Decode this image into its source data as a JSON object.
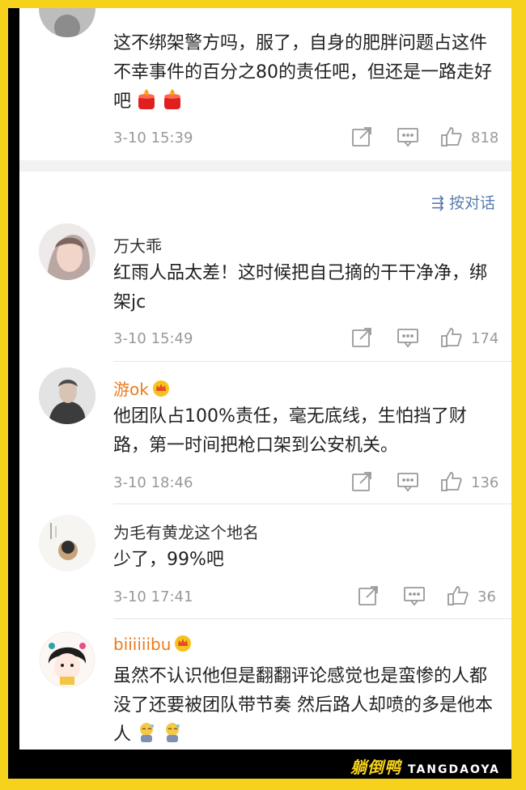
{
  "header": {
    "sort_label": "按对话"
  },
  "comments": [
    {
      "username": "",
      "text": "这不绑架警方吗，服了，自身的肥胖问题占这件不幸事件的百分之80的责任吧，但还是一路走好吧",
      "emojis": [
        "candle-emoji",
        "candle-emoji"
      ],
      "time": "3-10 15:39",
      "likes": "818",
      "vip": false
    },
    {
      "username": "万大乖",
      "text": "红雨人品太差！这时候把自己摘的干干净净，绑架jc",
      "time": "3-10 15:49",
      "likes": "174",
      "vip": false
    },
    {
      "username": "游ok",
      "text": "他团队占100%责任，毫无底线，生怕挡了财路，第一时间把枪口架到公安机关。",
      "time": "3-10 18:46",
      "likes": "136",
      "vip": true
    },
    {
      "username": "为毛有黄龙这个地名",
      "text": "少了，99%吧",
      "time": "3-10 17:41",
      "likes": "36",
      "vip": false
    },
    {
      "username": "biiiiiibu",
      "text": "虽然不认识他但是翻翻评论感觉也是蛮惨的人都没了还要被团队带节奏 然后路人却喷的多是他本人",
      "emojis": [
        "sweat-emoji",
        "sweat-emoji"
      ],
      "vip": true
    }
  ],
  "footer": {
    "logo_text": "躺倒鸭",
    "logo_pinyin": "TANGDAOYA"
  },
  "colors": {
    "frame": "#f7d21c",
    "username_vip": "#ec7a1c",
    "link": "#5a7dad",
    "muted": "#999999"
  }
}
